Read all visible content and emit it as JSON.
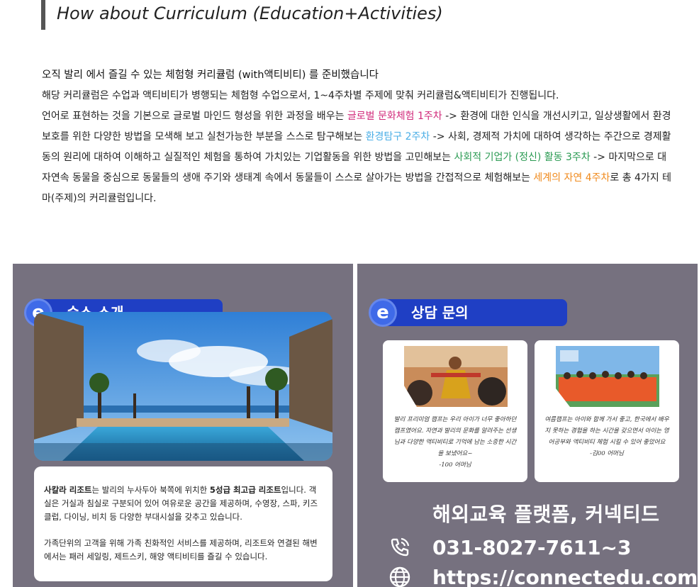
{
  "heading": "How about Curriculum (Education+Activities)",
  "intro": {
    "line1": "오직 발리 에서 즐길 수 있는 체험형 커리큘럼 (with액티비티) 를 준비했습니다",
    "line2": "해당 커리큘럼은 수업과 액티비티가 병행되는 체험형 수업으로서, 1~4주차별 주제에 맞춰 커리큘럼&액티비티가 진행됩니다.",
    "p3_a": "언어로 표현하는 것을 기본으로 글로벌 마인드 형성을 위한 과정을 배우는 ",
    "p3_hl1": "글로벌 문화체험 1주차",
    "p3_b": " -> 환경에 대한 인식을 개선시키고, 일상생활에서 환경보호를 위한 다양한 방법을 모색해 보고 실천가능한 부분을 스스로 탐구해보는 ",
    "p3_hl2": "환경탐구 2주차",
    "p3_c": " -> 사회, 경제적 가치에 대하여 생각하는 주간으로 경제활동의 원리에 대하여 이해하고 실질적인 체험을 통하여 가치있는 기업활동을 위한 방법을 고민해보는 ",
    "p3_hl3": "사회적 기업가 (정신) 활동 3주차",
    "p3_d": " -> 마지막으로 대자연속 동물을 중심으로 동물들의 생애 주기와 생태계 속에서 동물들이 스스로 살아가는 방법을 간접적으로 체험해보는 ",
    "p3_hl4": "세계의 자연 4주차",
    "p3_e": "로  총 4가지 테마(주제)의 커리큘럼입니다."
  },
  "left_panel": {
    "tag_label": "숙소 소개",
    "logo_letter": "e",
    "info_p1_bold1": "사칼라 리조트",
    "info_p1_a": "는 발리의 누사두아 북쪽에 위치한 ",
    "info_p1_bold2": "5성급 최고급 리조트",
    "info_p1_b": "입니다. 객실은 거실과 침실로 구분되어 있어 여유로운 공간을 제공하며, 수영장, 스파, 키즈 클럽, 다이닝, 비치 등 다양한 부대시설을 갖추고 있습니다.",
    "info_p2": "가족단위의 고객을 위해 가족 친화적인 서비스를 제공하며, 리조트와 연결된 해변에서는 패러 세일링, 제트스키, 해양 액티비티를 즐길 수 있습니다."
  },
  "right_panel": {
    "tag_label": "상담 문의",
    "logo_letter": "e",
    "review1": "발리 프리미엄 캠프는 우리 아이가 너무 좋아하던 캠프였어요. 자연과 발리의 문화를 알려주는 선생님과 다양한 액티비티로 기억에 남는 소중한 시간을 보냈어요~",
    "review1_sign": "-100 어머님",
    "review2": "여름캠프는 아이와 함께 가서 좋고, 한국에서 배우지 못하는 경험을 하는 시간을 갖으면서 아이는 영어공부와 액티비티 체험 시킬 수 있어 좋았어요",
    "review2_sign": "-김00 어머님",
    "brand": "해외교육 플랫폼, 커넥티드",
    "phone": "031-8027-7611~3",
    "url": "https://connectedu.com"
  },
  "colors": {
    "pink": "#d1297a",
    "blue": "#4aaee6",
    "green": "#2a9a52",
    "orange": "#f08a1c",
    "panel_bg": "#76717f",
    "tag_bg": "#1f3fc4"
  }
}
